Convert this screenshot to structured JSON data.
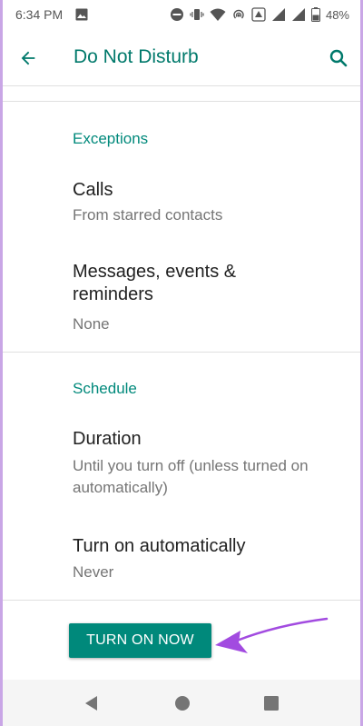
{
  "status_bar": {
    "time": "6:34 PM",
    "battery": "48%"
  },
  "app_bar": {
    "title": "Do Not Disturb",
    "back_icon": "arrow-left-icon",
    "search_icon": "search-icon"
  },
  "sections": {
    "exceptions": {
      "header": "Exceptions",
      "calls": {
        "title": "Calls",
        "summary": "From starred contacts"
      },
      "messages": {
        "title": "Messages, events & reminders",
        "summary": "None"
      }
    },
    "schedule": {
      "header": "Schedule",
      "duration": {
        "title": "Duration",
        "summary": "Until you turn off (unless turned on automatically)"
      },
      "auto": {
        "title": "Turn on automatically",
        "summary": "Never"
      }
    }
  },
  "action": {
    "turn_on_label": "TURN ON NOW"
  },
  "colors": {
    "accent": "#00897b",
    "arrow": "#a24be0"
  }
}
